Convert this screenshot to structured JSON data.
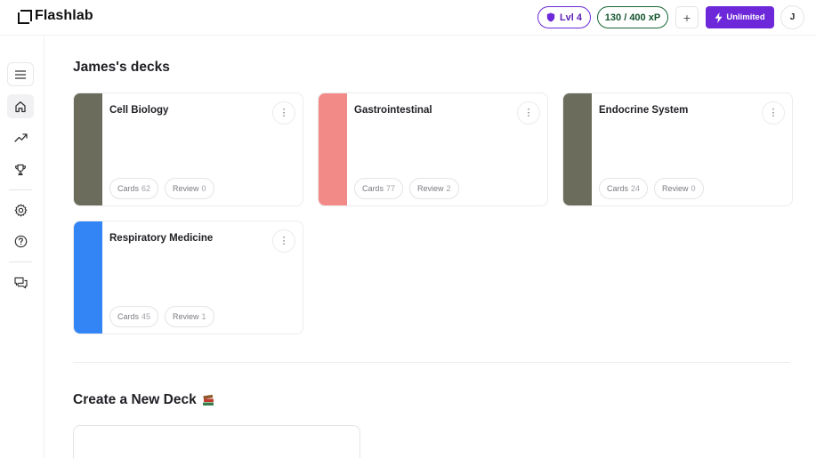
{
  "app": {
    "name": "Flashlab"
  },
  "header": {
    "level_label": "Lvl 4",
    "xp_label": "130 / 400 xP",
    "add_symbol": "+",
    "unlimited_label": "Unlimited",
    "avatar_initial": "J"
  },
  "sidebar": {
    "items": [
      {
        "icon": "menu-icon"
      },
      {
        "icon": "home-icon",
        "active": true
      },
      {
        "icon": "trending-up-icon"
      },
      {
        "icon": "trophy-icon"
      },
      {
        "icon": "gear-icon"
      },
      {
        "icon": "help-icon"
      },
      {
        "icon": "chat-icon"
      }
    ]
  },
  "main": {
    "decks_title": "James's decks",
    "decks": [
      {
        "name": "Cell Biology",
        "color": "#6b6c5b",
        "cards_label": "Cards",
        "cards": "62",
        "review_label": "Review",
        "review": "0"
      },
      {
        "name": "Gastrointestinal",
        "color": "#f28b88",
        "cards_label": "Cards",
        "cards": "77",
        "review_label": "Review",
        "review": "2"
      },
      {
        "name": "Endocrine System",
        "color": "#6b6c5b",
        "cards_label": "Cards",
        "cards": "24",
        "review_label": "Review",
        "review": "0"
      },
      {
        "name": "Respiratory Medicine",
        "color": "#3385f5",
        "cards_label": "Cards",
        "cards": "45",
        "review_label": "Review",
        "review": "1"
      }
    ],
    "create_title": "Create a New Deck",
    "create_emoji_icon": "books-icon"
  }
}
